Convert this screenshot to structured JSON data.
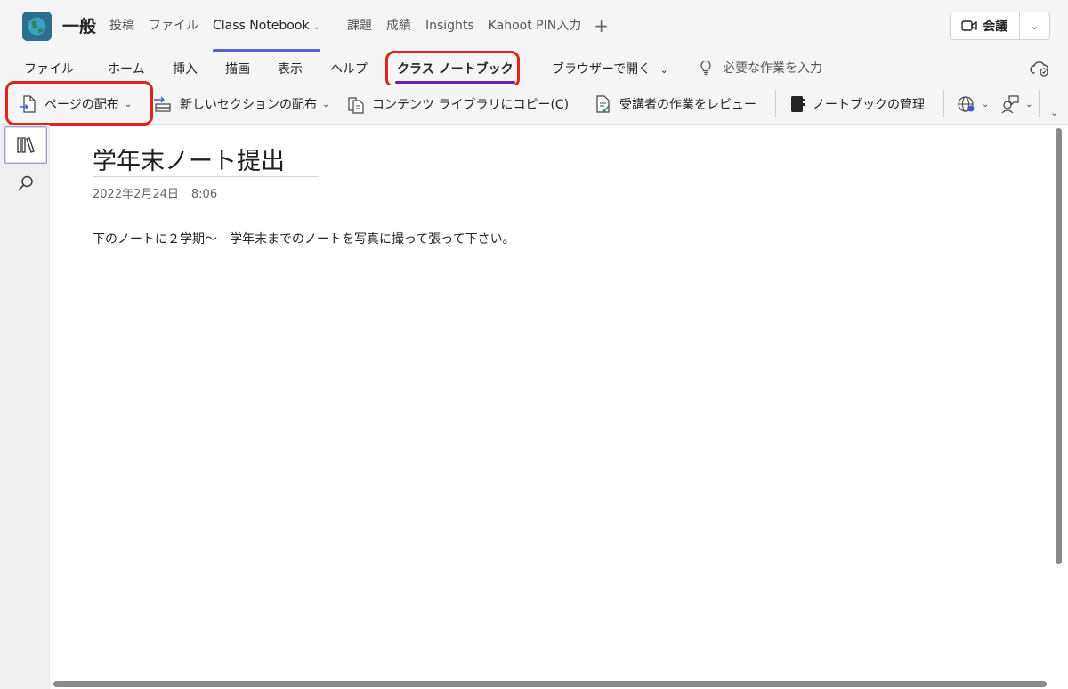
{
  "header": {
    "channel_name": "一般",
    "tabs": [
      {
        "label": "投稿"
      },
      {
        "label": "ファイル"
      },
      {
        "label": "Class Notebook"
      },
      {
        "label": "課題"
      },
      {
        "label": "成績"
      },
      {
        "label": "Insights"
      },
      {
        "label": "Kahoot PIN入力"
      }
    ],
    "add_tab_label": "+",
    "meet_label": "会議"
  },
  "ribbon": {
    "tabs": [
      {
        "label": "ファイル"
      },
      {
        "label": "ホーム"
      },
      {
        "label": "挿入"
      },
      {
        "label": "描画"
      },
      {
        "label": "表示"
      },
      {
        "label": "ヘルプ"
      },
      {
        "label": "クラス ノートブック"
      }
    ],
    "open_in_browser": "ブラウザーで開く",
    "tell_me_placeholder": "必要な作業を入力",
    "commands": {
      "distribute_page": "ページの配布",
      "distribute_section": "新しいセクションの配布",
      "copy_to_library": "コンテンツ ライブラリにコピー(C)",
      "review_work": "受講者の作業をレビュー",
      "manage_notebooks": "ノートブックの管理"
    }
  },
  "page": {
    "title": "学年末ノート提出",
    "date": "2022年2月24日",
    "time": "8:06",
    "body": "下のノートに２学期〜　学年末までのノートを写真に撮って張って下さい。"
  },
  "colors": {
    "highlight": "#e2231a",
    "active_tab_underline": "#7719aa",
    "channel_tab_underline": "#5b5fc7"
  }
}
